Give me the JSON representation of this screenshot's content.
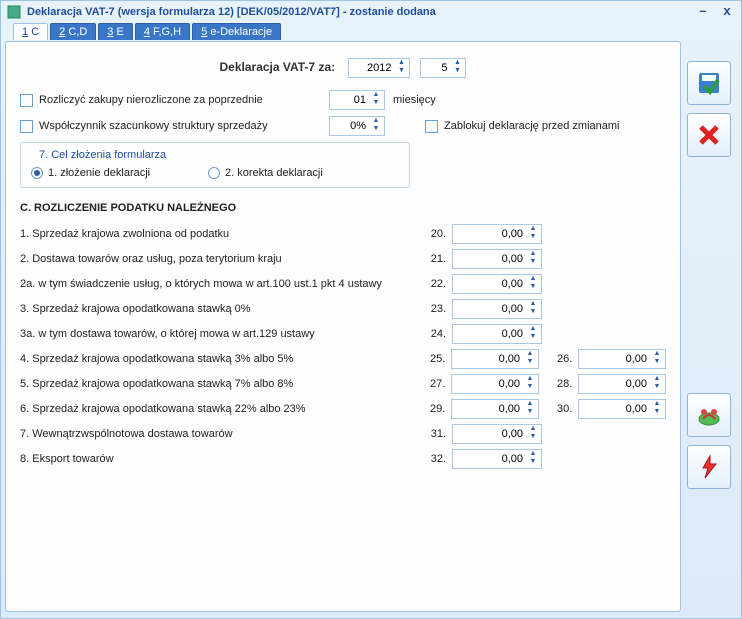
{
  "title": "Deklaracja VAT-7 (wersja formularza 12) [DEK/05/2012/VAT7] - zostanie dodana",
  "tabs": [
    {
      "k": "1",
      "l": "C"
    },
    {
      "k": "2",
      "l": "C,D"
    },
    {
      "k": "3",
      "l": "E"
    },
    {
      "k": "4",
      "l": "F,G,H"
    },
    {
      "k": "5",
      "l": "e-Deklaracje"
    }
  ],
  "header": {
    "label": "Deklaracja VAT-7 za:",
    "year": "2012",
    "month": "5"
  },
  "opts": {
    "rozlicz_label": "Rozliczyć zakupy nierozliczone za poprzednie",
    "rozlicz_val": "01",
    "rozlicz_suffix": "miesięcy",
    "wsp_label": "Współczynnik szacunkowy struktury sprzedaży",
    "wsp_val": "0%",
    "lock_label": "Zablokuj deklarację przed zmianami"
  },
  "cel": {
    "title": "7. Cel złożenia formularza",
    "r1": "1. złożenie deklaracji",
    "r2": "2. korekta deklaracji"
  },
  "sectionC": {
    "title": "C. ROZLICZENIE PODATKU NALEŻNEGO",
    "lines": [
      {
        "label": "1. Sprzedaż krajowa zwolniona od podatku",
        "n1": "20.",
        "v1": "0,00"
      },
      {
        "label": "2. Dostawa towarów oraz usług, poza terytorium kraju",
        "n1": "21.",
        "v1": "0,00"
      },
      {
        "label": "2a. w tym świadczenie usług, o których mowa w art.100 ust.1 pkt 4 ustawy",
        "n1": "22.",
        "v1": "0,00"
      },
      {
        "label": "3. Sprzedaż krajowa opodatkowana stawką 0%",
        "n1": "23.",
        "v1": "0,00"
      },
      {
        "label": "3a. w tym dostawa towarów, o której mowa w art.129 ustawy",
        "n1": "24.",
        "v1": "0,00"
      },
      {
        "label": "4. Sprzedaż krajowa opodatkowana stawką 3% albo 5%",
        "n1": "25.",
        "v1": "0,00",
        "n2": "26.",
        "v2": "0,00"
      },
      {
        "label": "5. Sprzedaż krajowa opodatkowana stawką 7% albo 8%",
        "n1": "27.",
        "v1": "0,00",
        "n2": "28.",
        "v2": "0,00"
      },
      {
        "label": "6. Sprzedaż krajowa opodatkowana stawką 22% albo 23%",
        "n1": "29.",
        "v1": "0,00",
        "n2": "30.",
        "v2": "0,00"
      },
      {
        "label": "7. Wewnątrzwspólnotowa dostawa towarów",
        "n1": "31.",
        "v1": "0,00"
      },
      {
        "label": "8. Eksport towarów",
        "n1": "32.",
        "v1": "0,00"
      }
    ]
  }
}
